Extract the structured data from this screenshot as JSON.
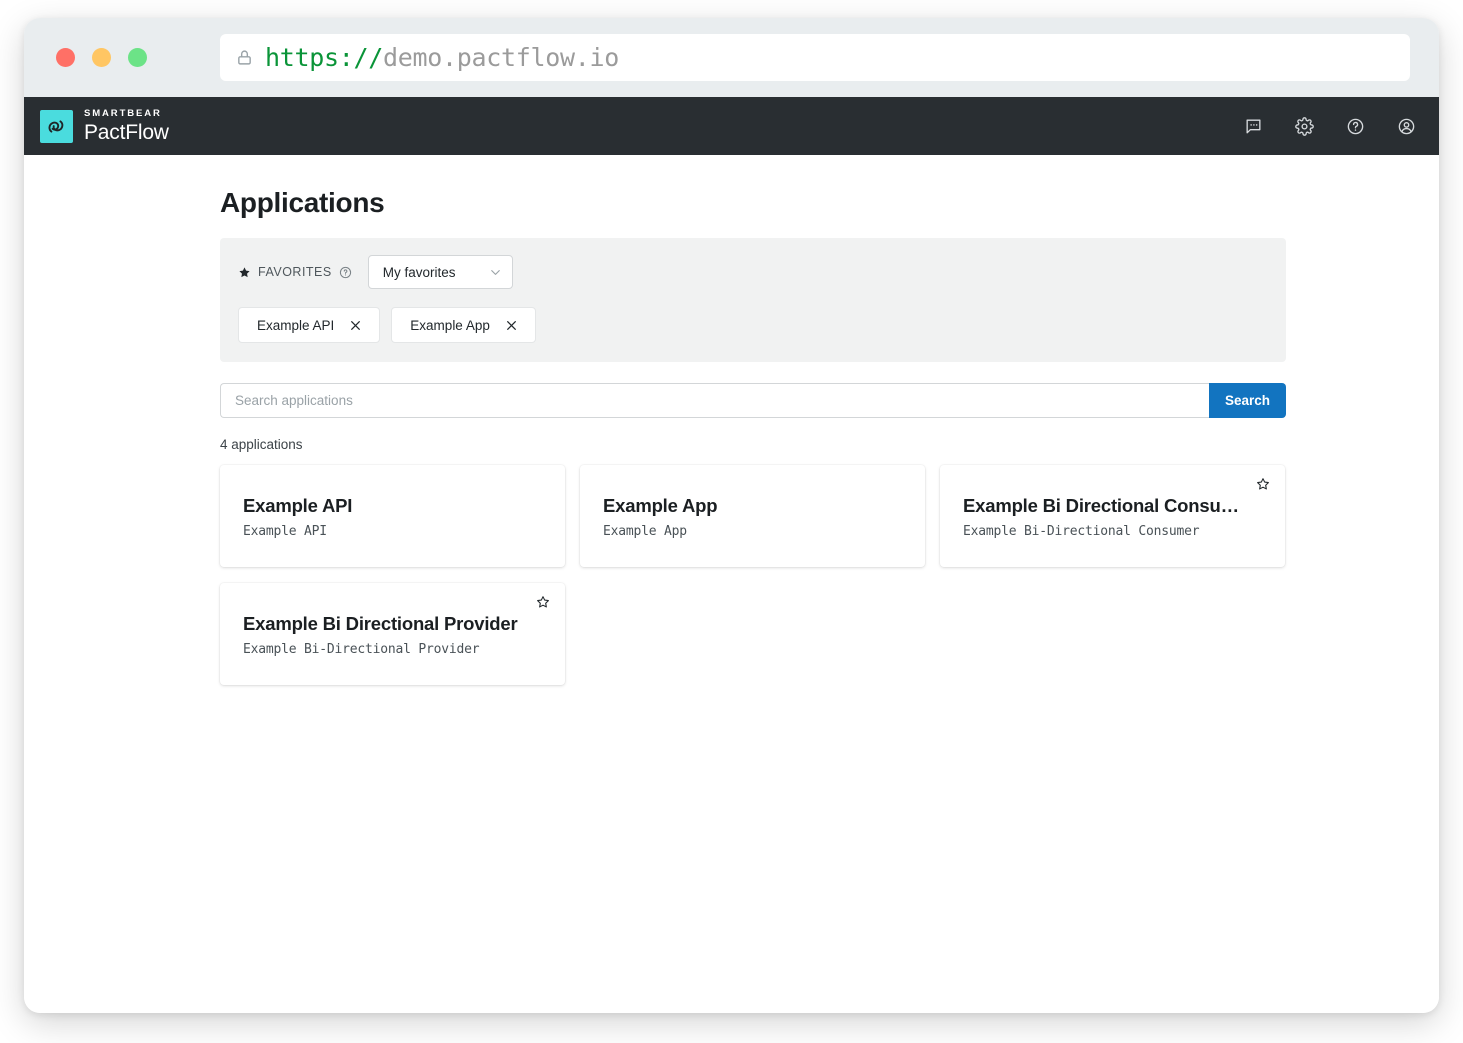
{
  "browser": {
    "traffic_lights": [
      "close",
      "minimize",
      "maximize"
    ],
    "url_scheme": "https://",
    "url_host": "demo.pactflow.io",
    "lock_icon": "lock-icon"
  },
  "header": {
    "brand_top": "SMARTBEAR",
    "brand_bottom": "PactFlow",
    "icons": [
      {
        "name": "chat-icon"
      },
      {
        "name": "gear-icon"
      },
      {
        "name": "help-icon"
      },
      {
        "name": "account-icon"
      }
    ]
  },
  "page": {
    "title": "Applications",
    "result_count": "4 applications"
  },
  "favorites": {
    "label": "FAVORITES",
    "help_icon": "help-circle-icon",
    "star_icon": "star-filled-icon",
    "select_value": "My favorites",
    "select_options": [
      "My favorites"
    ],
    "chips": [
      {
        "label": "Example API",
        "remove_icon": "close-icon"
      },
      {
        "label": "Example App",
        "remove_icon": "close-icon"
      }
    ]
  },
  "search": {
    "placeholder": "Search applications",
    "value": "",
    "button_label": "Search"
  },
  "applications": [
    {
      "title": "Example API",
      "subtitle": "Example API",
      "favorited": false
    },
    {
      "title": "Example App",
      "subtitle": "Example App",
      "favorited": false
    },
    {
      "title": "Example Bi Directional Consu…",
      "subtitle": "Example Bi-Directional Consumer",
      "favorited": true
    },
    {
      "title": "Example Bi Directional Provider",
      "subtitle": "Example Bi-Directional Provider",
      "favorited": true
    }
  ],
  "colors": {
    "header_bg": "#292e32",
    "brand_mark": "#4adcde",
    "accent_blue": "#1274c0",
    "panel_bg": "#f1f2f2",
    "chrome_bg": "#e9edef",
    "url_green": "#0a9438",
    "traffic_red": "#ff7066",
    "traffic_yellow": "#ffc663",
    "traffic_green": "#6ce387"
  }
}
